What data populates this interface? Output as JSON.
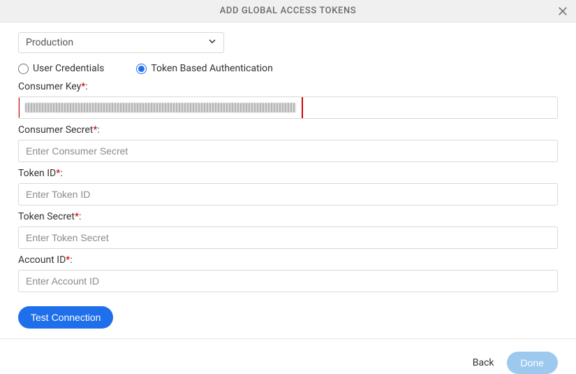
{
  "header": {
    "title": "ADD GLOBAL ACCESS TOKENS"
  },
  "env": {
    "selected": "Production"
  },
  "auth": {
    "user_credentials_label": "User Credentials",
    "token_based_label": "Token Based Authentication"
  },
  "fields": {
    "consumer_key": {
      "label": "Consumer Key",
      "value_redacted": true
    },
    "consumer_secret": {
      "label": "Consumer Secret",
      "placeholder": "Enter Consumer Secret",
      "value": ""
    },
    "token_id": {
      "label": "Token ID",
      "placeholder": "Enter Token ID",
      "value": ""
    },
    "token_secret": {
      "label": "Token Secret",
      "placeholder": "Enter Token Secret",
      "value": ""
    },
    "account_id": {
      "label": "Account ID",
      "placeholder": "Enter Account ID",
      "value": ""
    }
  },
  "buttons": {
    "test_connection": "Test Connection",
    "back": "Back",
    "done": "Done"
  },
  "asterisk": "*",
  "colon": ":"
}
